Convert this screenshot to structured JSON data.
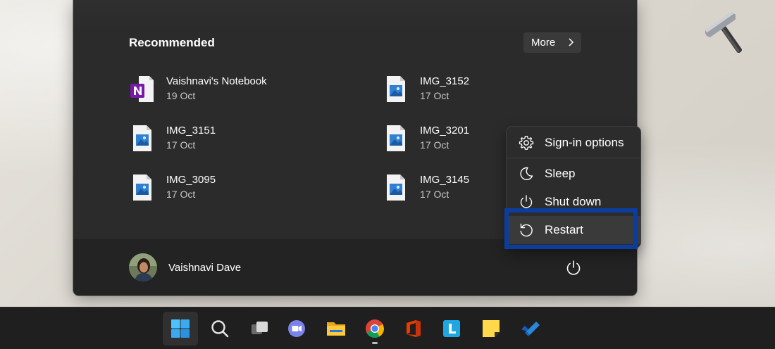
{
  "recommended": {
    "title": "Recommended",
    "more_label": "More",
    "items": [
      {
        "name": "Vaishnavi's Notebook",
        "date": "19 Oct",
        "icon": "onenote-file-icon"
      },
      {
        "name": "IMG_3152",
        "date": "17 Oct",
        "icon": "image-file-icon"
      },
      {
        "name": "IMG_3151",
        "date": "17 Oct",
        "icon": "image-file-icon"
      },
      {
        "name": "IMG_3201",
        "date": "17 Oct",
        "icon": "image-file-icon"
      },
      {
        "name": "IMG_3095",
        "date": "17 Oct",
        "icon": "image-file-icon"
      },
      {
        "name": "IMG_3145",
        "date": "17 Oct",
        "icon": "image-file-icon"
      }
    ]
  },
  "power_menu": {
    "items": [
      {
        "label": "Sign-in options",
        "icon": "gear-icon"
      },
      {
        "label": "Sleep",
        "icon": "moon-icon"
      },
      {
        "label": "Shut down",
        "icon": "power-icon"
      },
      {
        "label": "Restart",
        "icon": "restart-icon"
      }
    ],
    "highlighted": "Restart"
  },
  "user": {
    "name": "Vaishnavi Dave"
  },
  "taskbar": {
    "items": [
      {
        "name": "start",
        "icon": "windows-logo-icon"
      },
      {
        "name": "search",
        "icon": "search-icon"
      },
      {
        "name": "task-view",
        "icon": "task-view-icon"
      },
      {
        "name": "chat",
        "icon": "teams-chat-icon"
      },
      {
        "name": "file-explorer",
        "icon": "folder-icon"
      },
      {
        "name": "chrome",
        "icon": "chrome-icon"
      },
      {
        "name": "office",
        "icon": "office-icon"
      },
      {
        "name": "lightkey",
        "icon": "l-app-icon"
      },
      {
        "name": "sticky-notes",
        "icon": "sticky-notes-icon"
      },
      {
        "name": "todo",
        "icon": "todo-check-icon"
      }
    ]
  },
  "colors": {
    "menu_bg": "#2b2b2b",
    "footer_bg": "#232323",
    "highlight_border": "#0b3d9e",
    "taskbar_bg": "#1f1f1f"
  }
}
